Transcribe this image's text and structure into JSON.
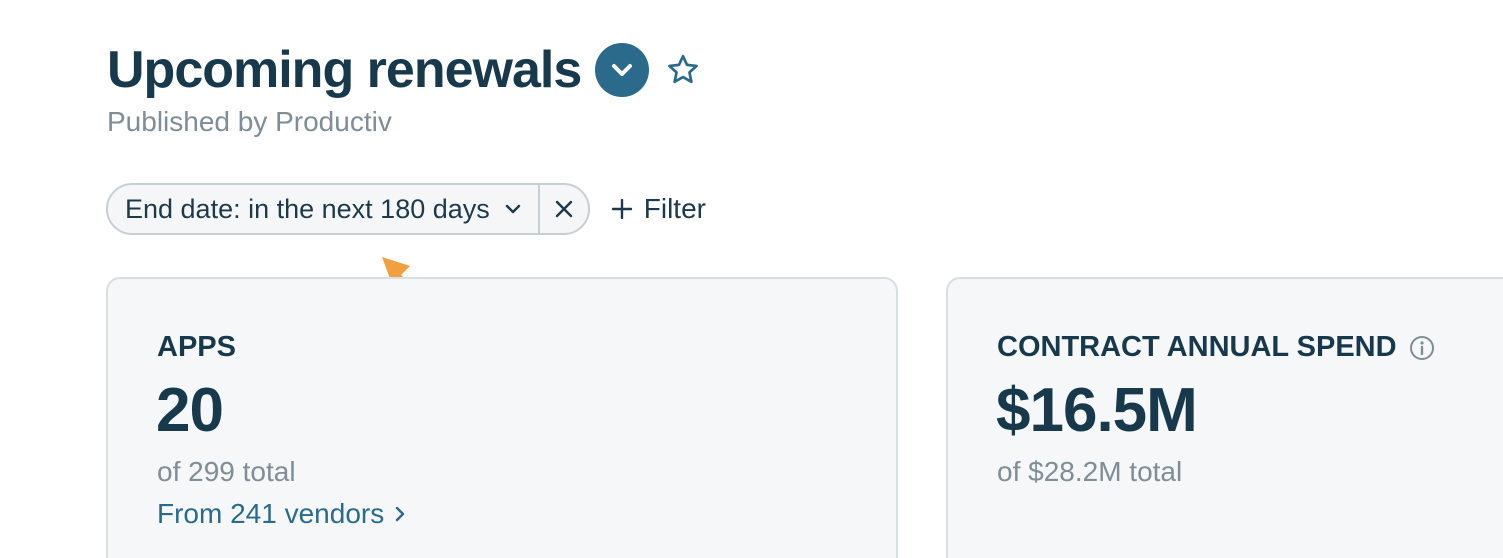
{
  "header": {
    "title": "Upcoming renewals",
    "subtitle": "Published by Productiv",
    "dropdown_icon": "chevron-down-icon",
    "favorite_icon": "star-outline-icon"
  },
  "filters": {
    "active": [
      {
        "label": "End date: in the next 180 days"
      }
    ],
    "add_label": "Filter"
  },
  "cards": {
    "apps": {
      "label": "APPS",
      "value": "20",
      "sub": "of 299 total",
      "link": "From 241 vendors"
    },
    "spend": {
      "label": "CONTRACT ANNUAL SPEND",
      "value": "$16.5M",
      "sub": "of $28.2M total"
    }
  },
  "colors": {
    "heading": "#17394b",
    "accent": "#2c6a8b",
    "muted": "#7e8d96",
    "annotation_arrow": "#f0a040",
    "card_bg": "#f5f7f8",
    "card_border": "#d9dee1"
  }
}
